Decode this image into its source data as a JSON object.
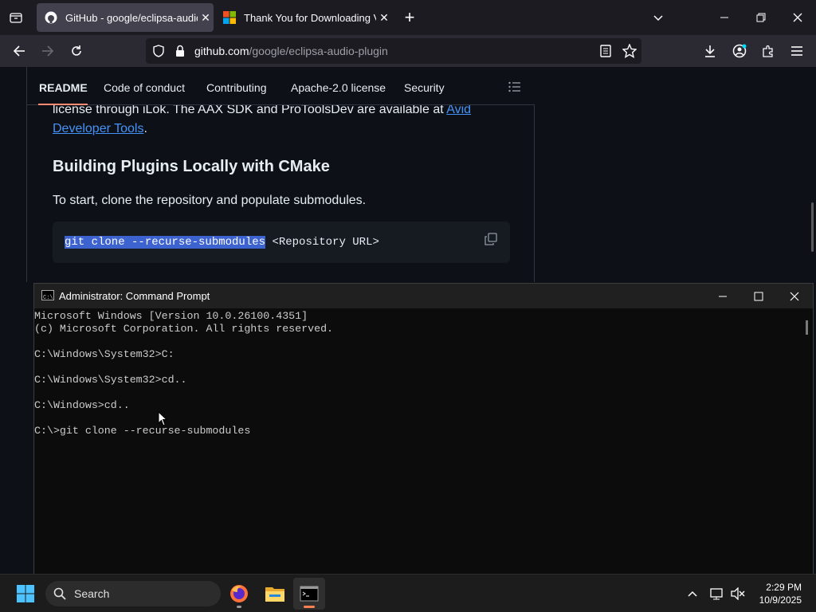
{
  "browser": {
    "tabs": [
      {
        "title": "GitHub - google/eclipsa-audio-",
        "active": true,
        "close": "✕"
      },
      {
        "title": "Thank You for Downloading Visu",
        "active": false,
        "close": "✕"
      }
    ],
    "new_tab": "+",
    "url_domain": "github.com",
    "url_path": "/google/eclipsa-audio-plugin"
  },
  "readme": {
    "nav": [
      "README",
      "Code of conduct",
      "Contributing",
      "Apache-2.0 license",
      "Security"
    ],
    "para1_text": "license through iLok. The AAX SDK and ProToolsDev are available at ",
    "para1_link1": "Avid",
    "para1_link2": "Developer Tools",
    "para1_end": ".",
    "heading": "Building Plugins Locally with CMake",
    "para2": "To start, clone the repository and populate submodules.",
    "code_selected": "git clone --recurse-submodules",
    "code_rest": " <Repository URL>"
  },
  "cmd": {
    "title": "Administrator: Command Prompt",
    "lines": [
      "Microsoft Windows [Version 10.0.26100.4351]",
      "(c) Microsoft Corporation. All rights reserved.",
      "",
      "C:\\Windows\\System32>C:",
      "",
      "C:\\Windows\\System32>cd..",
      "",
      "C:\\Windows>cd..",
      "",
      "C:\\>git clone --recurse-submodules"
    ]
  },
  "taskbar": {
    "search_label": "Search",
    "time": "2:29 PM",
    "date": "10/9/2025"
  },
  "colors": {
    "link": "#4493f8",
    "selection": "#3d63d0",
    "nav_underline": "#fd8c73"
  }
}
